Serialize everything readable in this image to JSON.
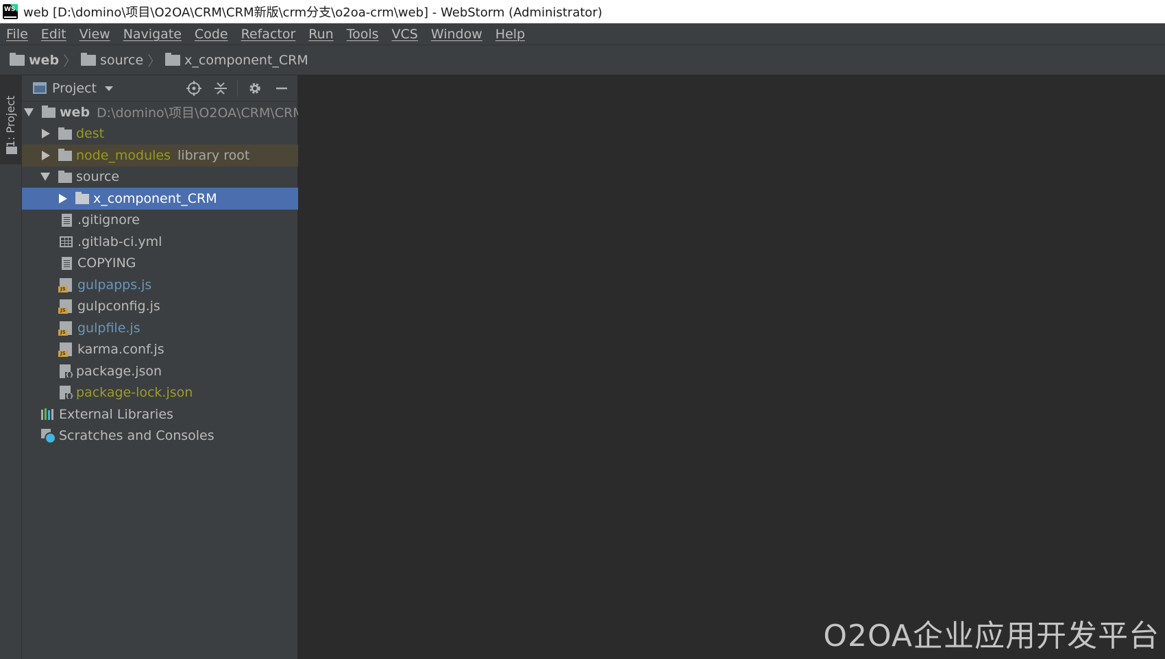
{
  "window": {
    "title": "web [D:\\domino\\项目\\O2OA\\CRM\\CRM新版\\crm分支\\o2oa-crm\\web] - WebStorm (Administrator)",
    "app_icon_text": "WS"
  },
  "menu": [
    "File",
    "Edit",
    "View",
    "Navigate",
    "Code",
    "Refactor",
    "Run",
    "Tools",
    "VCS",
    "Window",
    "Help"
  ],
  "breadcrumbs": [
    "web",
    "source",
    "x_component_CRM"
  ],
  "side_stripe": {
    "label": "1: Project"
  },
  "project_panel": {
    "title": "Project",
    "tools": [
      "locate-icon",
      "collapse-all-icon",
      "gear-icon",
      "minimize-icon"
    ]
  },
  "tree": {
    "root": {
      "name": "web",
      "path": "D:\\domino\\项目\\O2OA\\CRM\\CRM新"
    },
    "dest": "dest",
    "node_modules": "node_modules",
    "node_modules_note": "library root",
    "source": "source",
    "x_component": "x_component_CRM",
    "files": [
      ".gitignore",
      ".gitlab-ci.yml",
      "COPYING",
      "gulpapps.js",
      "gulpconfig.js",
      "gulpfile.js",
      "karma.conf.js",
      "package.json",
      "package-lock.json"
    ],
    "external_libraries": "External Libraries",
    "scratches": "Scratches and Consoles"
  },
  "colors": {
    "modified_file": "#6897bb",
    "ignored_file": "#999a1b",
    "selection": "#4b6eaf"
  },
  "watermark": "O2OA企业应用开发平台"
}
